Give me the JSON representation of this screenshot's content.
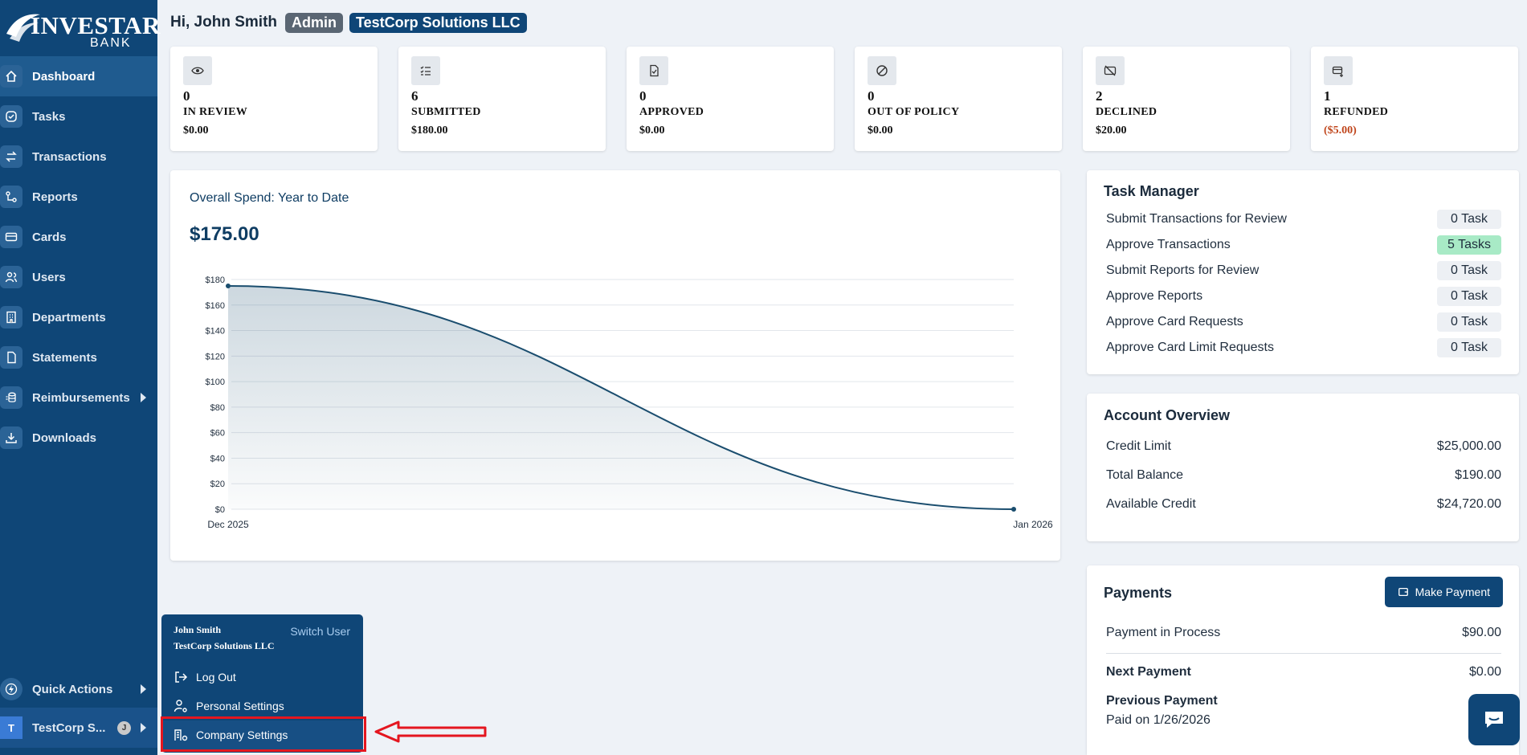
{
  "brand": {
    "name": "INVESTAR",
    "sub": "BANK"
  },
  "nav": [
    {
      "label": "Dashboard",
      "icon": "home-icon",
      "active": true
    },
    {
      "label": "Tasks",
      "icon": "check-circle-icon"
    },
    {
      "label": "Transactions",
      "icon": "arrows-exchange-icon"
    },
    {
      "label": "Reports",
      "icon": "report-icon"
    },
    {
      "label": "Cards",
      "icon": "credit-card-icon"
    },
    {
      "label": "Users",
      "icon": "users-icon"
    },
    {
      "label": "Departments",
      "icon": "building-icon"
    },
    {
      "label": "Statements",
      "icon": "document-icon"
    },
    {
      "label": "Reimbursements",
      "icon": "coins-icon",
      "caret": true
    },
    {
      "label": "Downloads",
      "icon": "download-icon"
    }
  ],
  "bottom": {
    "quick_actions": "Quick Actions",
    "company_short": "TestCorp S...",
    "company_initial": "T",
    "user_initial": "J"
  },
  "header": {
    "greeting": "Hi, John Smith",
    "role": "Admin",
    "company": "TestCorp Solutions LLC"
  },
  "stats": [
    {
      "count": "0",
      "label": "IN REVIEW",
      "amount": "$0.00",
      "icon": "eye-icon"
    },
    {
      "count": "6",
      "label": "SUBMITTED",
      "amount": "$180.00",
      "icon": "list-check-icon"
    },
    {
      "count": "0",
      "label": "APPROVED",
      "amount": "$0.00",
      "icon": "file-check-icon"
    },
    {
      "count": "0",
      "label": "OUT OF POLICY",
      "amount": "$0.00",
      "icon": "ban-icon"
    },
    {
      "count": "2",
      "label": "DECLINED",
      "amount": "$20.00",
      "icon": "card-off-icon"
    },
    {
      "count": "1",
      "label": "REFUNDED",
      "amount": "($5.00)",
      "icon": "card-refund-icon",
      "negative": true
    }
  ],
  "spend": {
    "title": "Overall Spend: Year to Date",
    "total": "$175.00"
  },
  "chart_data": {
    "type": "area",
    "x": [
      "Dec 2025",
      "Jan 2026"
    ],
    "values": [
      175,
      0
    ],
    "ylim": [
      0,
      180
    ],
    "yticks": [
      "$0",
      "$20",
      "$40",
      "$60",
      "$80",
      "$100",
      "$120",
      "$140",
      "$160",
      "$180"
    ],
    "grid": true,
    "color": "#1a4d6e"
  },
  "task_manager": {
    "title": "Task Manager",
    "rows": [
      {
        "label": "Submit Transactions for Review",
        "count": "0 Task"
      },
      {
        "label": "Approve Transactions",
        "count": "5 Tasks",
        "highlight": true
      },
      {
        "label": "Submit Reports for Review",
        "count": "0 Task"
      },
      {
        "label": "Approve Reports",
        "count": "0 Task"
      },
      {
        "label": "Approve Card Requests",
        "count": "0 Task"
      },
      {
        "label": "Approve Card Limit Requests",
        "count": "0 Task"
      }
    ]
  },
  "account_overview": {
    "title": "Account Overview",
    "rows": [
      {
        "label": "Credit Limit",
        "value": "$25,000.00"
      },
      {
        "label": "Total Balance",
        "value": "$190.00"
      },
      {
        "label": "Available Credit",
        "value": "$24,720.00"
      }
    ]
  },
  "payments": {
    "title": "Payments",
    "button": "Make Payment",
    "in_process_label": "Payment in Process",
    "in_process_value": "$90.00",
    "next_label": "Next Payment",
    "next_value": "$0.00",
    "previous_label": "Previous Payment",
    "previous_date": "Paid on 1/26/2026",
    "previous_value": "$"
  },
  "popup": {
    "user_name": "John Smith",
    "company": "TestCorp Solutions LLC",
    "switch": "Switch User",
    "items": [
      {
        "label": "Log Out",
        "icon": "logout-icon"
      },
      {
        "label": "Personal Settings",
        "icon": "user-gear-icon"
      },
      {
        "label": "Company Settings",
        "icon": "building-gear-icon"
      }
    ]
  },
  "colors": {
    "sidebar": "#0f4677",
    "accent_green": "#a8eac6",
    "negative": "#c0461c",
    "annotation": "#e4161f"
  }
}
